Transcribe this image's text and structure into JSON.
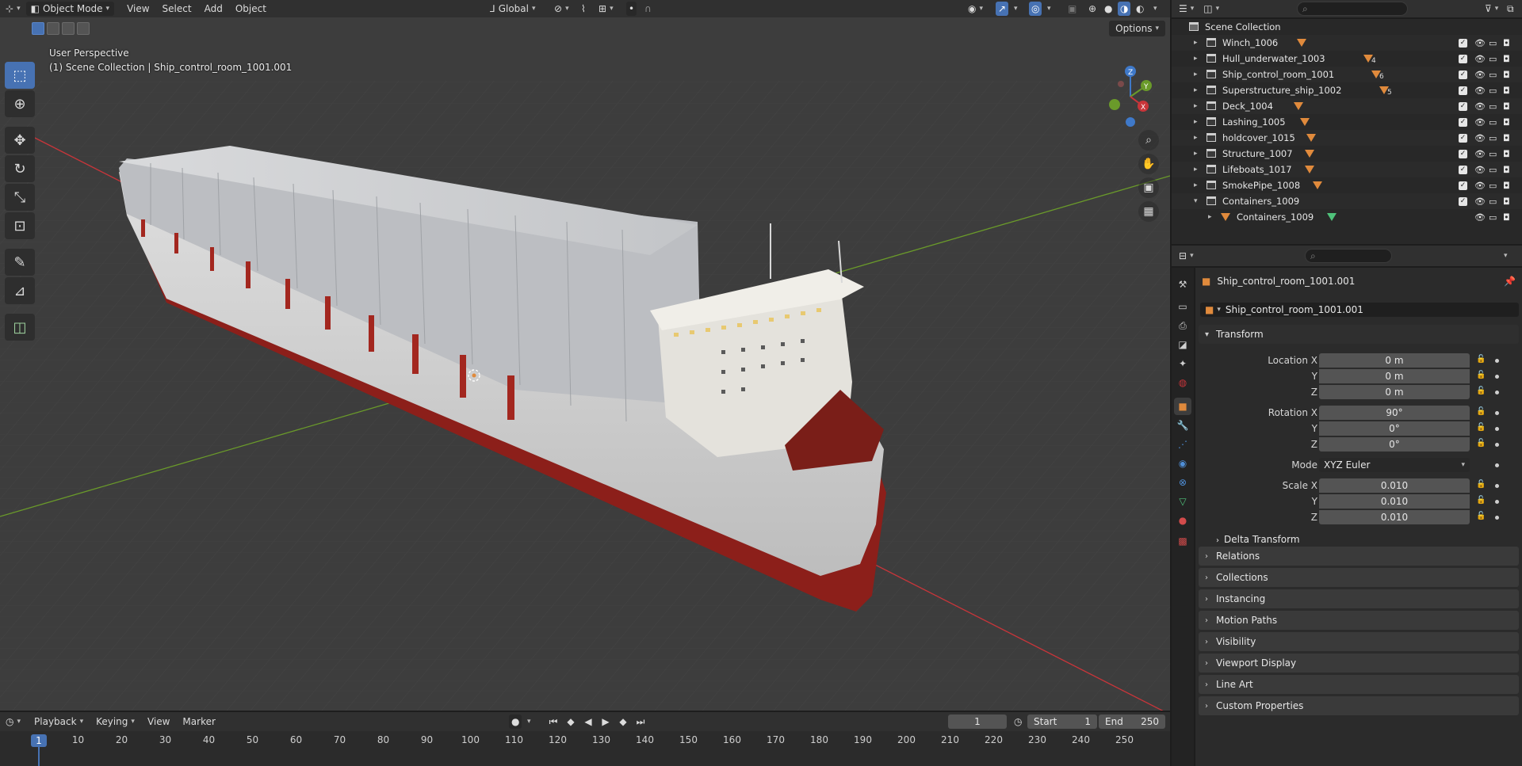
{
  "viewport_header": {
    "mode": "Object Mode",
    "menus": [
      "View",
      "Select",
      "Add",
      "Object"
    ],
    "orientation": "Global"
  },
  "viewport": {
    "perspective_label": "User Perspective",
    "context_label": "(1) Scene Collection | Ship_control_room_1001.001",
    "options_label": "Options",
    "gizmo_axes": [
      "X",
      "Y",
      "Z"
    ]
  },
  "timeline": {
    "menus": [
      "Playback",
      "Keying",
      "View",
      "Marker"
    ],
    "current_frame": "1",
    "start_label": "Start",
    "start_value": "1",
    "end_label": "End",
    "end_value": "250",
    "ruler": [
      "1",
      "10",
      "20",
      "30",
      "40",
      "50",
      "60",
      "70",
      "80",
      "90",
      "100",
      "110",
      "120",
      "130",
      "140",
      "150",
      "160",
      "170",
      "180",
      "190",
      "200",
      "210",
      "220",
      "230",
      "240",
      "250"
    ]
  },
  "outliner": {
    "root": "Scene Collection",
    "items": [
      {
        "name": "Winch_1006",
        "count": ""
      },
      {
        "name": "Hull_underwater_1003",
        "count": "4"
      },
      {
        "name": "Ship_control_room_1001",
        "count": "6"
      },
      {
        "name": "Superstructure_ship_1002",
        "count": "5"
      },
      {
        "name": "Deck_1004",
        "count": ""
      },
      {
        "name": "Lashing_1005",
        "count": ""
      },
      {
        "name": "holdcover_1015",
        "count": ""
      },
      {
        "name": "Structure_1007",
        "count": ""
      },
      {
        "name": "Lifeboats_1017",
        "count": ""
      },
      {
        "name": "SmokePipe_1008",
        "count": ""
      },
      {
        "name": "Containers_1009",
        "count": ""
      }
    ],
    "child": "Containers_1009"
  },
  "properties": {
    "object_name": "Ship_control_room_1001.001",
    "data_name": "Ship_control_room_1001.001",
    "transform_label": "Transform",
    "location_label": "Location X",
    "location": [
      "0 m",
      "0 m",
      "0 m"
    ],
    "rotation_label": "Rotation X",
    "rotation": [
      "90°",
      "0°",
      "0°"
    ],
    "mode_label": "Mode",
    "mode_value": "XYZ Euler",
    "scale_label": "Scale X",
    "scale": [
      "0.010",
      "0.010",
      "0.010"
    ],
    "axis_y": "Y",
    "axis_z": "Z",
    "delta_transform": "Delta Transform",
    "panels": [
      "Relations",
      "Collections",
      "Instancing",
      "Motion Paths",
      "Visibility",
      "Viewport Display",
      "Line Art",
      "Custom Properties"
    ]
  },
  "colors": {
    "accent": "#4772b3",
    "hull_red": "#8c1f1a",
    "object_orange": "#e08a3c",
    "axis_x": "#c8353a",
    "axis_y": "#6a9a2a"
  }
}
